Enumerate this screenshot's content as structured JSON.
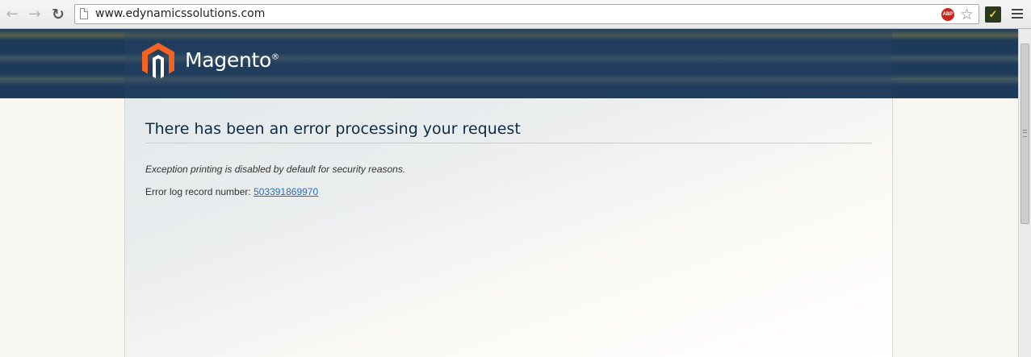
{
  "browser": {
    "url": "www.edynamicssolutions.com",
    "back_icon": "back-arrow-icon",
    "forward_icon": "forward-arrow-icon",
    "reload_icon": "reload-icon",
    "abp_label": "ABP",
    "star_icon": "bookmark-star-icon",
    "menu_icon": "menu-icon"
  },
  "header": {
    "logo_text": "Magento",
    "logo_mark": "®",
    "brand_color": "#f26322",
    "background_color": "#1d3a5a"
  },
  "main": {
    "title": "There has been an error processing your request",
    "exception_note": "Exception printing is disabled by default for security reasons.",
    "log_label": "Error log record number:",
    "log_number": "503391869970"
  }
}
